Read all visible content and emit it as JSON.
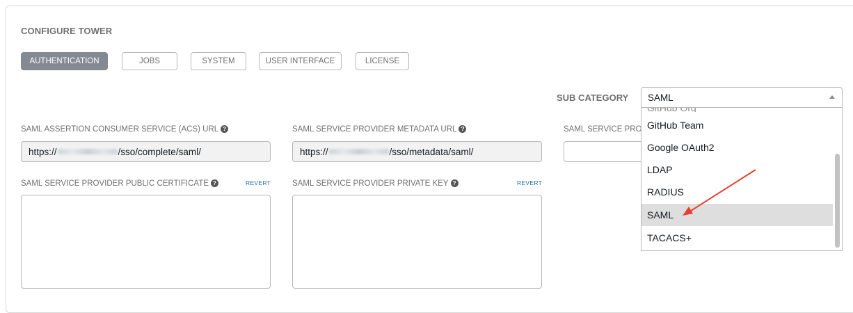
{
  "page": {
    "title": "CONFIGURE TOWER",
    "tabs": [
      {
        "label": "AUTHENTICATION",
        "active": true
      },
      {
        "label": "JOBS",
        "active": false
      },
      {
        "label": "SYSTEM",
        "active": false
      },
      {
        "label": "USER INTERFACE",
        "active": false
      },
      {
        "label": "LICENSE",
        "active": false
      }
    ]
  },
  "sub_category": {
    "label": "SUB CATEGORY",
    "selected": "SAML",
    "options": [
      "GitHub Team",
      "Google OAuth2",
      "LDAP",
      "RADIUS",
      "SAML",
      "TACACS+"
    ]
  },
  "fields": {
    "acs_url": {
      "label": "SAML ASSERTION CONSUMER SERVICE (ACS) URL",
      "value_prefix": "https://",
      "value_suffix": "/sso/complete/saml/"
    },
    "metadata_url": {
      "label": "SAML SERVICE PROVIDER METADATA URL",
      "value_prefix": "https://",
      "value_suffix": "/sso/metadata/saml/"
    },
    "entity_id": {
      "label": "SAML SERVICE PRO"
    },
    "public_cert": {
      "label": "SAML SERVICE PROVIDER PUBLIC CERTIFICATE",
      "revert": "REVERT"
    },
    "private_key": {
      "label": "SAML SERVICE PROVIDER PRIVATE KEY",
      "revert": "REVERT"
    }
  },
  "colors": {
    "active_tab": "#848992",
    "revert_link": "#1f6ca8",
    "annotation_arrow": "#e8402f",
    "selected_option_bg": "#dedede"
  }
}
